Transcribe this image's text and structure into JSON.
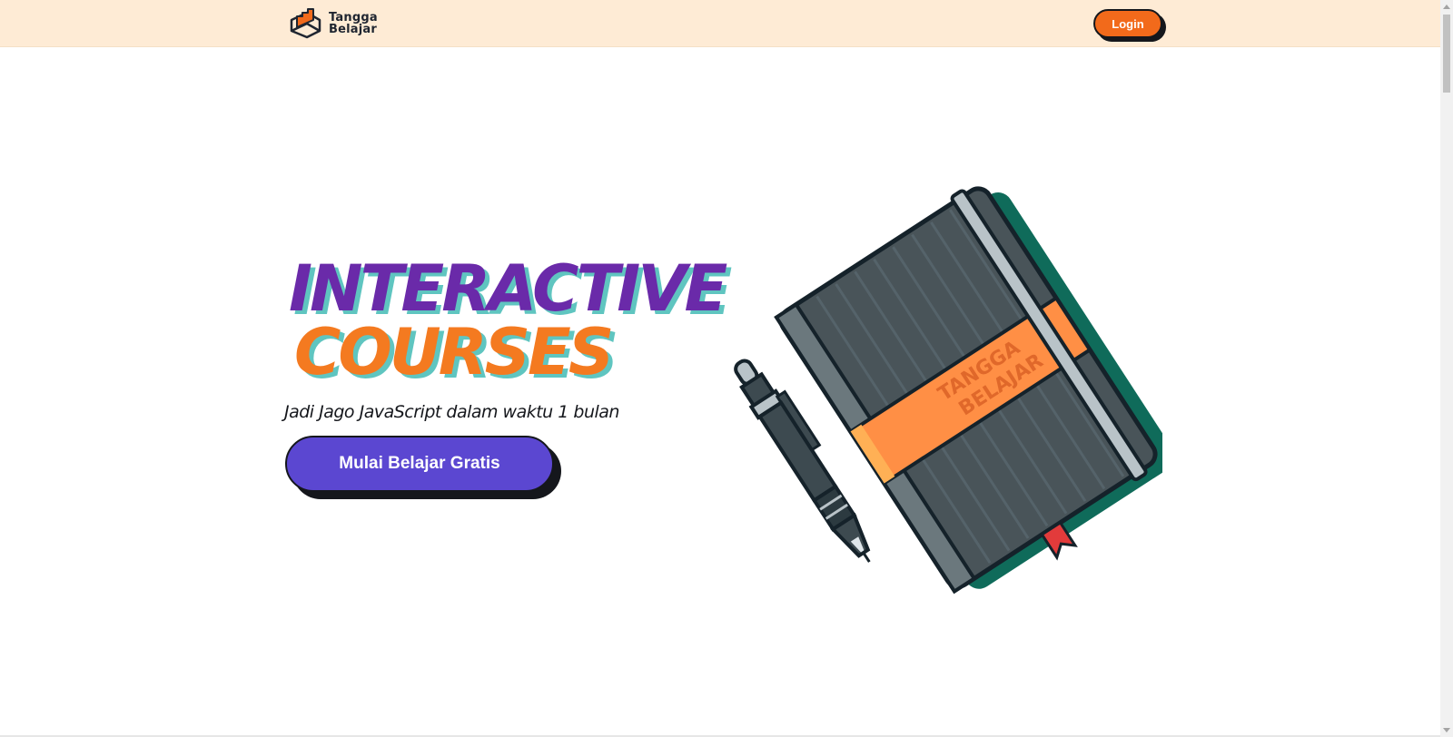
{
  "navbar": {
    "brand_line1": "Tangga",
    "brand_line2": "Belajar",
    "login_label": "Login"
  },
  "hero": {
    "title_line1": "INTERACTIVE",
    "title_line2": "COURSES",
    "subtitle": "Jadi Jago JavaScript dalam waktu 1 bulan",
    "cta_label": "Mulai Belajar Gratis",
    "notebook_label_line1": "TANGGA",
    "notebook_label_line2": "BELAJAR"
  },
  "colors": {
    "navbar_bg": "#feebd5",
    "accent_orange": "#f26a1b",
    "title_purple": "#6a2aa9",
    "title_orange": "#f47a20",
    "title_shadow": "#5fc5c0",
    "cta_purple": "#5b47d1",
    "dark": "#15171c"
  },
  "icons": {
    "logo": "stairs-book-logo-icon",
    "illustration": "notebook-and-pen-illustration"
  }
}
